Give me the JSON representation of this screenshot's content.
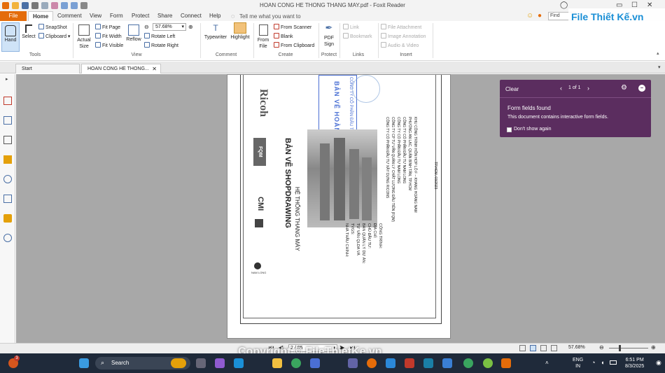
{
  "window": {
    "title": "HOAN CONG HE THONG THANG MAY.pdf - Foxit Reader"
  },
  "ribbon_tabs": [
    "File",
    "Home",
    "Comment",
    "View",
    "Form",
    "Protect",
    "Share",
    "Connect",
    "Help"
  ],
  "tell_me": "Tell me what you want to",
  "find_placeholder": "Find",
  "brand": "File Thiết Kế.vn",
  "tools": {
    "hand": "Hand",
    "select": "Select",
    "snapshot": "SnapShot",
    "clipboard": "Clipboard",
    "group_label": "Tools"
  },
  "view": {
    "actual_size": "Actual Size",
    "fit_page": "Fit Page",
    "fit_width": "Fit Width",
    "fit_visible": "Fit Visible",
    "reflow": "Reflow",
    "zoom_value": "57.68%",
    "rotate_left": "Rotate Left",
    "rotate_right": "Rotate Right",
    "group_label": "View"
  },
  "comment": {
    "typewriter": "Typewriter",
    "highlight": "Highlight",
    "group_label": "Comment"
  },
  "create": {
    "from_file": "From File",
    "from_scanner": "From Scanner",
    "blank": "Blank",
    "from_clipboard": "From Clipboard",
    "group_label": "Create"
  },
  "protect": {
    "pdf_sign": "PDF Sign",
    "group_label": "Protect"
  },
  "links": {
    "link": "Link",
    "bookmark": "Bookmark",
    "group_label": "Links"
  },
  "insert": {
    "file_attachment": "File Attachment",
    "image_annotation": "Image Annotation",
    "audio_video": "Audio & Video",
    "group_label": "Insert"
  },
  "doc_tabs": [
    "Start",
    "HOAN CONG HE THONG..."
  ],
  "notice": {
    "clear": "Clear",
    "pager": "1 of 1",
    "title": "Form fields found",
    "message": "This document contains interactive form fields.",
    "dont_show": "Don't show again"
  },
  "pdf": {
    "brand_right": "Ricoh",
    "fqm": "FQM",
    "cmi": "CMI",
    "title": "BẢN VẼ SHOPDRAWING",
    "subtitle": "HỆ THỐNG THANG MÁY",
    "stamp": "BẢN VẼ HOÀN CÔNG",
    "stamp_company": "CÔNG TY CỔ PHẦN ĐẦU TƯ XÂY DỰNG",
    "project_labels": [
      "CÔNG TRÌNH:",
      "ĐỊA CHỈ:",
      "CHỦ ĐẦU TƯ:",
      "BAN QUẢN LÝ DỰ ÁN:",
      "TƯ VẤN QLDA VÀ TVGS:",
      "NHÀ THẦU CHÍNH:"
    ],
    "project_values": [
      "KHU CÔNG TRÌNH HỖN HỢP LÔ F – KHANG HOÀNG NAM",
      "PHƯỜNG AN LẠC, QUẬN BÌNH TÂN, TP.HCM",
      "CÔNG TY CỔ PHẦN ĐẦU TƯ NAM LONG",
      "CÔNG TY CỔ PHẦN ĐẦU TƯ NAM LONG",
      "CÔNG TY CP TƯ VẤN QUẢN LÝ CHẤT LƯỢNG ĐẦU TIÊN (FQM)",
      "CÔNG TY CỔ PHẦN ĐẦU TƯ XÂY DỰNG RICONS"
    ],
    "date": "TP.HCM, 03/2023",
    "nam_long": "NAM LONG"
  },
  "statusbar": {
    "page_field": "2 / 85",
    "zoom": "57.68%"
  },
  "watermark": "Copyright © FileThietKe.vn",
  "taskbar": {
    "search": "Search",
    "lang": "ENG",
    "lang2": "IN",
    "time": "6:51 PM",
    "date": "8/3/2025",
    "badge": "3"
  },
  "colors": {
    "accent": "#e46c0a",
    "notice_bg": "#5b2d5f",
    "taskbar_bg": "#1f2a3a",
    "workspace": "#a8a8a8"
  }
}
